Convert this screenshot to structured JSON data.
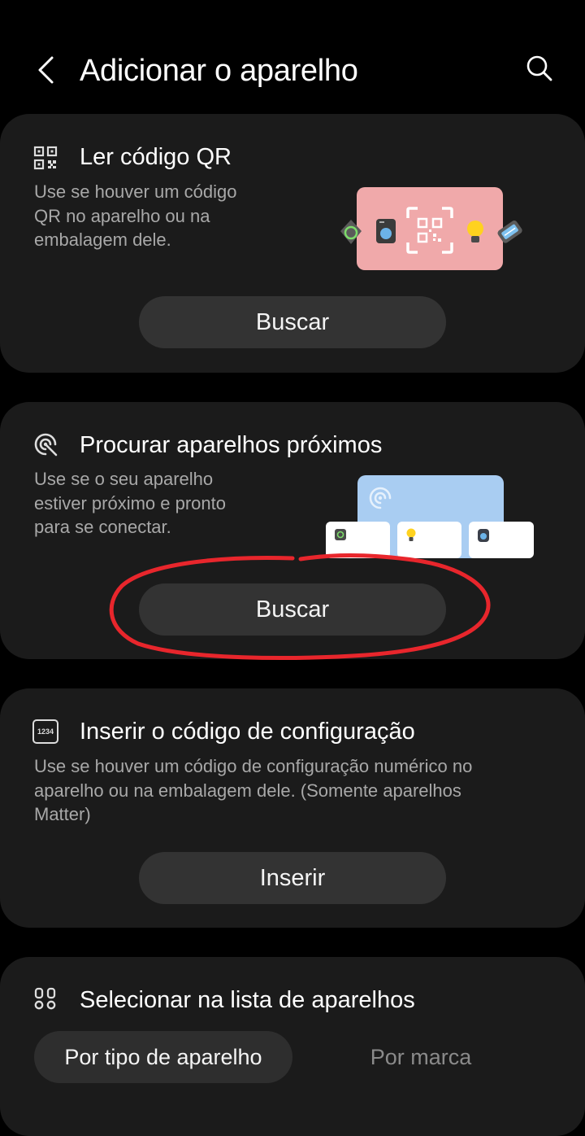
{
  "header": {
    "title": "Adicionar o aparelho"
  },
  "cards": {
    "qr": {
      "title": "Ler código QR",
      "description_lines": [
        "Use se houver um código",
        "QR no aparelho ou na",
        "embalagem dele."
      ],
      "button": "Buscar"
    },
    "nearby": {
      "title": "Procurar aparelhos próximos",
      "description_lines": [
        "Use se o seu aparelho",
        "estiver próximo e pronto",
        "para se conectar."
      ],
      "button": "Buscar"
    },
    "setup_code": {
      "title": "Inserir o código de configuração",
      "icon_text": "1234",
      "description_lines": [
        "Use se houver um código de configuração numérico no",
        "aparelho ou na embalagem dele. (Somente aparelhos",
        "Matter)"
      ],
      "button": "Inserir"
    },
    "device_list": {
      "title": "Selecionar na lista de aparelhos",
      "tabs": [
        {
          "label": "Por tipo de aparelho",
          "selected": true
        },
        {
          "label": "Por marca",
          "selected": false
        }
      ]
    }
  },
  "annotation": {
    "color": "#e8262c",
    "target": "nearby-search-button"
  },
  "colors": {
    "background": "#000000",
    "card": "#1b1b1b",
    "button": "#333333",
    "secondary_text": "#a8a8a8"
  }
}
